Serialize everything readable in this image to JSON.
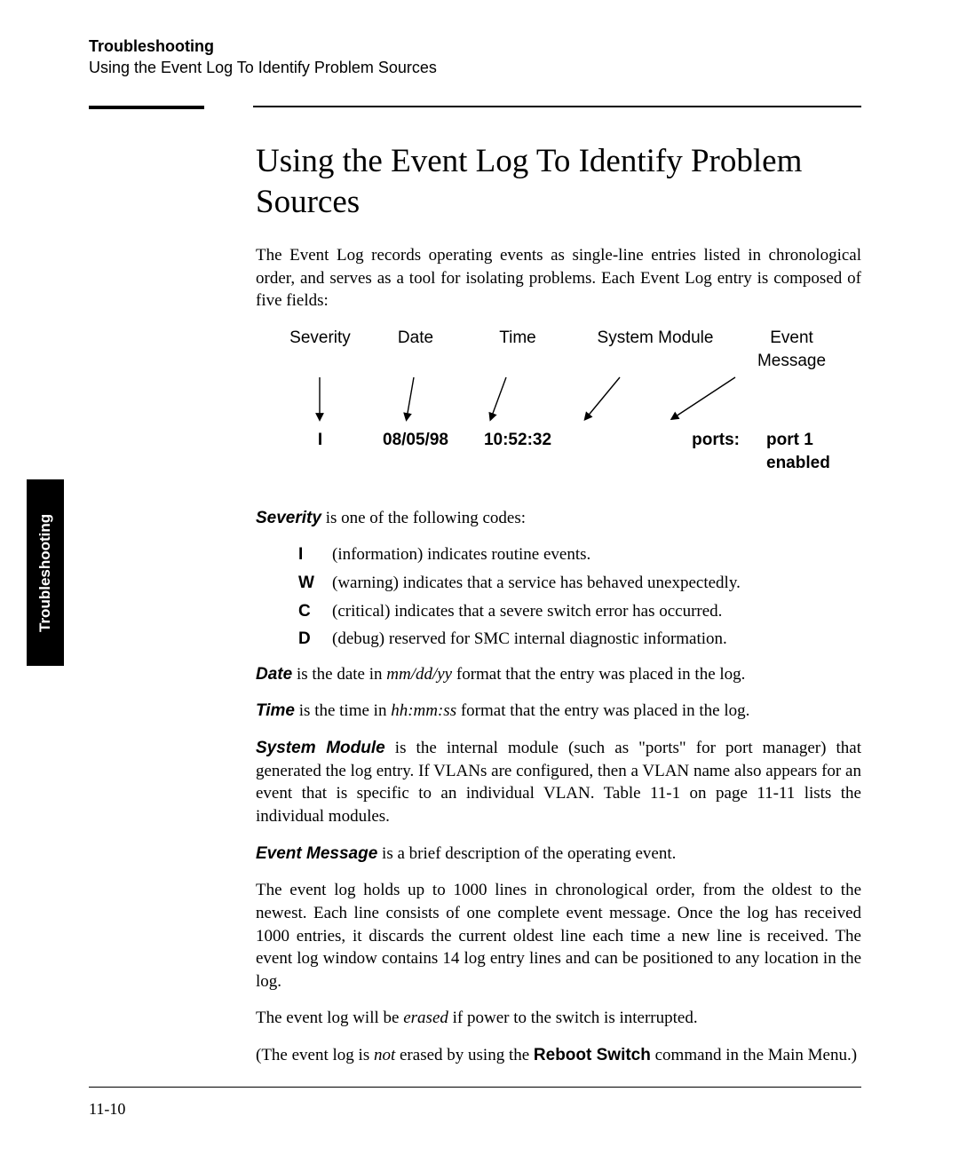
{
  "header": {
    "chapter": "Troubleshooting",
    "section": "Using the Event Log To Identify Problem Sources"
  },
  "side_tab": "Troubleshooting",
  "heading": "Using the Event Log To Identify Problem Sources",
  "intro": "The Event Log records operating events as single-line entries listed in chronological order, and serves as a tool for isolating problems. Each Event Log entry is composed of five fields:",
  "diagram": {
    "labels": {
      "severity": "Severity",
      "date": "Date",
      "time": "Time",
      "module": "System Module",
      "message": "Event Message"
    },
    "values": {
      "severity": "I",
      "date": "08/05/98",
      "time": "10:52:32",
      "module": "ports:",
      "message": "port 1 enabled"
    }
  },
  "severity_block": {
    "lead_term": "Severity",
    "lead_rest": " is one of the following codes:",
    "codes": [
      {
        "code": "I",
        "desc": "(information) indicates routine events."
      },
      {
        "code": "W",
        "desc": "(warning) indicates that a service has behaved unexpectedly."
      },
      {
        "code": "C",
        "desc": "(critical) indicates that a severe switch error has occurred."
      },
      {
        "code": "D",
        "desc": "(debug) reserved for SMC internal diagnostic information."
      }
    ]
  },
  "date_line": {
    "term": "Date",
    "before": " is the date in ",
    "ital": "mm/dd/yy",
    "after": " format that the entry was placed in the log."
  },
  "time_line": {
    "term": "Time",
    "before": " is the time in ",
    "ital": "hh:mm:ss",
    "after": " format that the entry was placed in the log."
  },
  "module_line": {
    "term": "System Module",
    "rest": " is the internal module (such as \"ports\" for port manager) that generated the log entry. If VLANs are configured, then a VLAN name also appears for an event that is specific to an individual VLAN. Table 11-1 on page 11-11 lists the individual modules."
  },
  "event_msg_line": {
    "term": "Event Message",
    "rest": " is a brief description of the operating event."
  },
  "para_1000": "The event log holds up to 1000 lines in chronological order, from the oldest to the newest. Each line consists of one complete event message. Once the log has received 1000 entries, it discards the current oldest line each time a new line is received. The event log window contains 14 log entry lines and can be positioned to any location in the log.",
  "erased_line": {
    "before": "The event log will be ",
    "ital": "erased",
    "after": " if power to the switch is interrupted."
  },
  "reboot_line": {
    "before": "(The event log is ",
    "ital": "not",
    "mid": " erased by using the  ",
    "bold": "Reboot Switch",
    "after": "  command in the Main Menu.)"
  },
  "page_number": "11-10"
}
